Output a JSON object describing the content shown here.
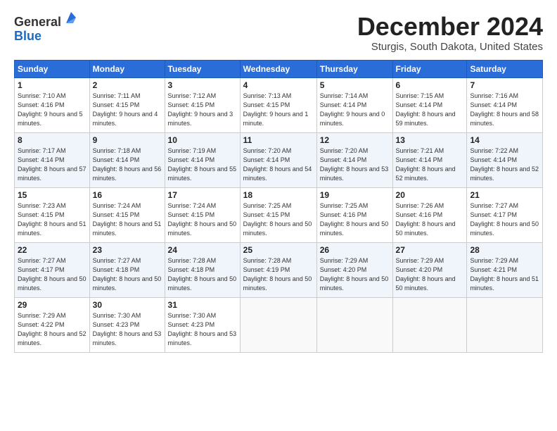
{
  "header": {
    "logo_general": "General",
    "logo_blue": "Blue",
    "month_title": "December 2024",
    "location": "Sturgis, South Dakota, United States"
  },
  "calendar": {
    "days_header": [
      "Sunday",
      "Monday",
      "Tuesday",
      "Wednesday",
      "Thursday",
      "Friday",
      "Saturday"
    ],
    "weeks": [
      [
        null,
        {
          "day": "2",
          "sunrise": "7:11 AM",
          "sunset": "4:15 PM",
          "daylight": "9 hours and 4 minutes."
        },
        {
          "day": "3",
          "sunrise": "7:12 AM",
          "sunset": "4:15 PM",
          "daylight": "9 hours and 3 minutes."
        },
        {
          "day": "4",
          "sunrise": "7:13 AM",
          "sunset": "4:15 PM",
          "daylight": "9 hours and 1 minute."
        },
        {
          "day": "5",
          "sunrise": "7:14 AM",
          "sunset": "4:14 PM",
          "daylight": "9 hours and 0 minutes."
        },
        {
          "day": "6",
          "sunrise": "7:15 AM",
          "sunset": "4:14 PM",
          "daylight": "8 hours and 59 minutes."
        },
        {
          "day": "7",
          "sunrise": "7:16 AM",
          "sunset": "4:14 PM",
          "daylight": "8 hours and 58 minutes."
        }
      ],
      [
        {
          "day": "1",
          "sunrise": "7:10 AM",
          "sunset": "4:16 PM",
          "daylight": "9 hours and 5 minutes."
        },
        null,
        null,
        null,
        null,
        null,
        null
      ],
      [
        {
          "day": "8",
          "sunrise": "7:17 AM",
          "sunset": "4:14 PM",
          "daylight": "8 hours and 57 minutes."
        },
        {
          "day": "9",
          "sunrise": "7:18 AM",
          "sunset": "4:14 PM",
          "daylight": "8 hours and 56 minutes."
        },
        {
          "day": "10",
          "sunrise": "7:19 AM",
          "sunset": "4:14 PM",
          "daylight": "8 hours and 55 minutes."
        },
        {
          "day": "11",
          "sunrise": "7:20 AM",
          "sunset": "4:14 PM",
          "daylight": "8 hours and 54 minutes."
        },
        {
          "day": "12",
          "sunrise": "7:20 AM",
          "sunset": "4:14 PM",
          "daylight": "8 hours and 53 minutes."
        },
        {
          "day": "13",
          "sunrise": "7:21 AM",
          "sunset": "4:14 PM",
          "daylight": "8 hours and 52 minutes."
        },
        {
          "day": "14",
          "sunrise": "7:22 AM",
          "sunset": "4:14 PM",
          "daylight": "8 hours and 52 minutes."
        }
      ],
      [
        {
          "day": "15",
          "sunrise": "7:23 AM",
          "sunset": "4:15 PM",
          "daylight": "8 hours and 51 minutes."
        },
        {
          "day": "16",
          "sunrise": "7:24 AM",
          "sunset": "4:15 PM",
          "daylight": "8 hours and 51 minutes."
        },
        {
          "day": "17",
          "sunrise": "7:24 AM",
          "sunset": "4:15 PM",
          "daylight": "8 hours and 50 minutes."
        },
        {
          "day": "18",
          "sunrise": "7:25 AM",
          "sunset": "4:15 PM",
          "daylight": "8 hours and 50 minutes."
        },
        {
          "day": "19",
          "sunrise": "7:25 AM",
          "sunset": "4:16 PM",
          "daylight": "8 hours and 50 minutes."
        },
        {
          "day": "20",
          "sunrise": "7:26 AM",
          "sunset": "4:16 PM",
          "daylight": "8 hours and 50 minutes."
        },
        {
          "day": "21",
          "sunrise": "7:27 AM",
          "sunset": "4:17 PM",
          "daylight": "8 hours and 50 minutes."
        }
      ],
      [
        {
          "day": "22",
          "sunrise": "7:27 AM",
          "sunset": "4:17 PM",
          "daylight": "8 hours and 50 minutes."
        },
        {
          "day": "23",
          "sunrise": "7:27 AM",
          "sunset": "4:18 PM",
          "daylight": "8 hours and 50 minutes."
        },
        {
          "day": "24",
          "sunrise": "7:28 AM",
          "sunset": "4:18 PM",
          "daylight": "8 hours and 50 minutes."
        },
        {
          "day": "25",
          "sunrise": "7:28 AM",
          "sunset": "4:19 PM",
          "daylight": "8 hours and 50 minutes."
        },
        {
          "day": "26",
          "sunrise": "7:29 AM",
          "sunset": "4:20 PM",
          "daylight": "8 hours and 50 minutes."
        },
        {
          "day": "27",
          "sunrise": "7:29 AM",
          "sunset": "4:20 PM",
          "daylight": "8 hours and 50 minutes."
        },
        {
          "day": "28",
          "sunrise": "7:29 AM",
          "sunset": "4:21 PM",
          "daylight": "8 hours and 51 minutes."
        }
      ],
      [
        {
          "day": "29",
          "sunrise": "7:29 AM",
          "sunset": "4:22 PM",
          "daylight": "8 hours and 52 minutes."
        },
        {
          "day": "30",
          "sunrise": "7:30 AM",
          "sunset": "4:23 PM",
          "daylight": "8 hours and 53 minutes."
        },
        {
          "day": "31",
          "sunrise": "7:30 AM",
          "sunset": "4:23 PM",
          "daylight": "8 hours and 53 minutes."
        },
        null,
        null,
        null,
        null
      ]
    ]
  }
}
